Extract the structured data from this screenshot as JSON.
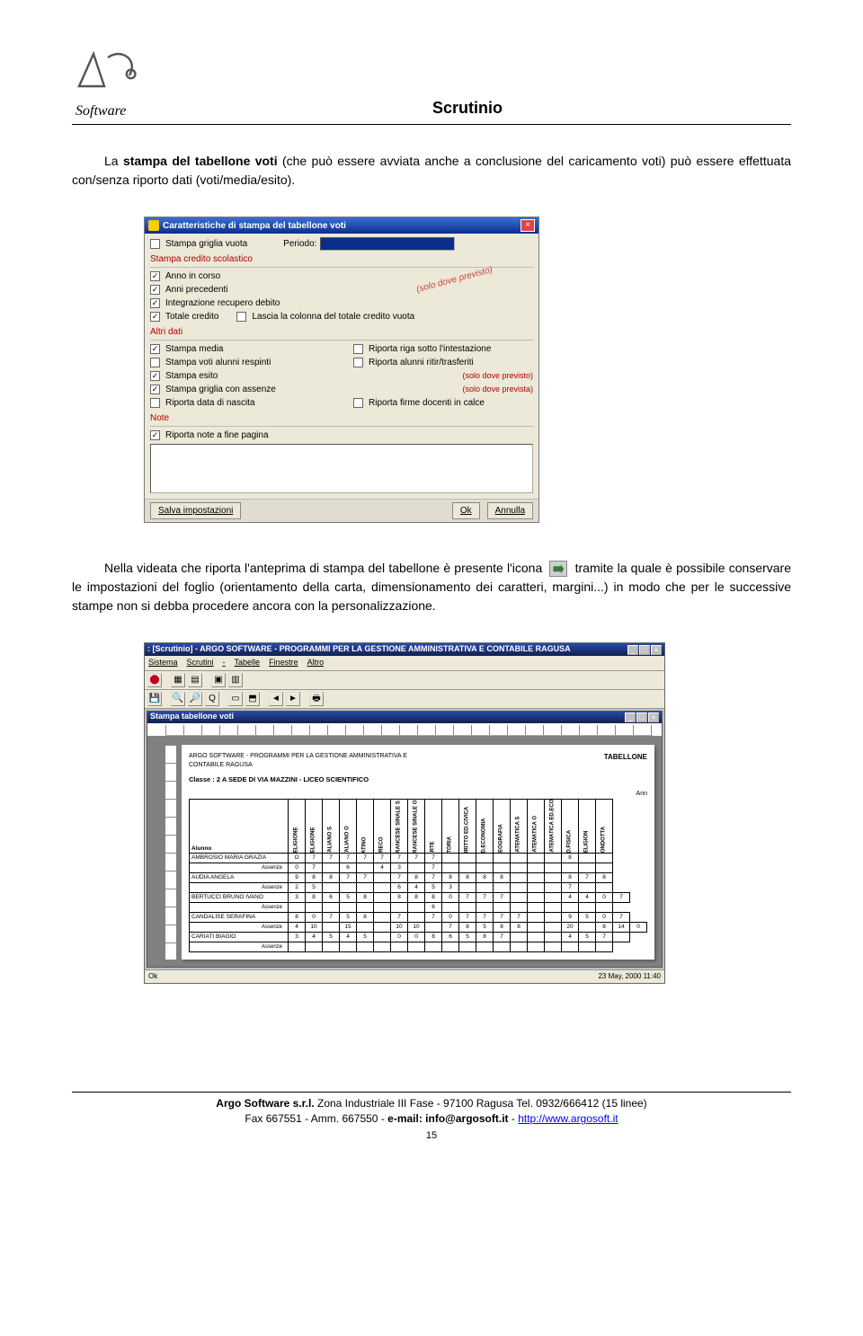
{
  "header": {
    "logo_word": "Software",
    "title": "Scrutinio"
  },
  "para1_a": "La ",
  "para1_b": "stampa del tabellone voti",
  "para1_c": " (che può essere avviata anche a conclusione del caricamento voti) può essere effettuata con/senza riporto dati (voti/media/esito).",
  "dialog1": {
    "title": "Caratteristiche  di stampa del tabellone voti",
    "top_row": {
      "griglia": "Stampa griglia vuota",
      "periodo_lbl": "Periodo:"
    },
    "group_credito": "Stampa credito scolastico",
    "credito": {
      "anno_corso": "Anno in corso",
      "anni_prec": "Anni precedenti",
      "integr": "Integrazione recupero debito",
      "totale": "Totale credito",
      "lascia": "Lascia la colonna del totale credito vuota"
    },
    "wm1": "(solo dove previsto)",
    "group_altri": "Altri dati",
    "altri": {
      "media": "Stampa media",
      "respinti": "Stampa voti alunni respinti",
      "esito": "Stampa esito",
      "griglia_ass": "Stampa griglia con assenze",
      "data_nasc": "Riporta data di nascita",
      "riga_sotto": "Riporta riga sotto l'intestazione",
      "ritir": "Riporta alunni ritir/trasferiti",
      "solo1": "(solo dove previsto)",
      "solo2": "(solo dove prevista)",
      "firme": "Riporta firme docenti in calce"
    },
    "group_note": "Note",
    "note_cb": "Riporta note a fine pagina",
    "btn_save": "Salva impostazioni",
    "btn_ok": "Ok",
    "btn_annulla": "Annulla"
  },
  "para2_a": "Nella videata che riporta l'anteprima di stampa del tabellone è presente l'icona",
  "para2_b": "tramite la quale è possibile conservare le impostazioni del foglio (orientamento della carta, dimensionamento dei caratteri, margini...) in modo che per le successive stampe non si debba procedere ancora con la personalizzazione.",
  "appwin": {
    "title": ": [Scrutinio] - ARGO SOFTWARE - PROGRAMMI PER LA GESTIONE AMMINISTRATIVA E CONTABILE RAGUSA",
    "menu": [
      "Sistema",
      "Scrutini",
      "-",
      "Tabelle",
      "Finestre",
      "Altro"
    ],
    "sub_title": "Stampa tabellone voti",
    "paper_header1": "ARGO SOFTWARE - PROGRAMMI PER LA GESTIONE AMMINISTRATIVA E",
    "paper_header2": "CONTABILE RAGUSA",
    "tabellone": "TABELLONE",
    "classe": "Classe : 2 A SEDE DI VIA MAZZINI - LICEO SCIENTIFICO",
    "ann": "Ann",
    "alunno_hdr": "Alunno",
    "assenze_lbl": "Assenze",
    "subjects": [
      "RELIGIONE",
      "RELIGIONE",
      "ITALIANO S",
      "ITALIANO O",
      "LATINO",
      "GRECO",
      "FRANCESE SINALE S",
      "FRANCESE SINALE O",
      "ARTE",
      "STORIA",
      "DIRITTO ED.CIVICA",
      "ED.ECONOMIA",
      "GEOGRAFIA",
      "MATEMATICA S",
      "MATEMATICA O",
      "MATEMATICA ED.ECONOMIA",
      "ED.FISICA",
      "RELIGION",
      "CONDOTTA"
    ],
    "students": [
      {
        "name": "AMBROSIO MARIA GRAZIA",
        "grades": [
          "O",
          "7",
          "7",
          "7",
          "7",
          "7",
          "7",
          "7",
          "7",
          "",
          "",
          "",
          "",
          "",
          "",
          "",
          "8",
          "",
          ""
        ],
        "abs": [
          "0",
          "7",
          "",
          "6",
          "",
          "4",
          "3",
          "",
          "7",
          "",
          "",
          "",
          "",
          "",
          "",
          "",
          "",
          "",
          ""
        ]
      },
      {
        "name": "AUDIA ANGELA",
        "grades": [
          "9",
          "8",
          "8",
          "7",
          "7",
          "",
          "7",
          "8",
          "7",
          "8",
          "8",
          "8",
          "8",
          "",
          "",
          "",
          "8",
          "7",
          "8"
        ],
        "abs": [
          "2",
          "5",
          "",
          "",
          "",
          "",
          "6",
          "4",
          "5",
          "3",
          "",
          "",
          "",
          "",
          "",
          "",
          "7",
          "",
          ""
        ]
      },
      {
        "name": "BERTUCCI BRUNO IVANO",
        "grades": [
          "3",
          "8",
          "6",
          "5",
          "8",
          "",
          "8",
          "8",
          "8",
          "0",
          "7",
          "7",
          "7",
          "",
          "",
          "",
          "4",
          "4",
          "0",
          "7"
        ],
        "abs": [
          "",
          "",
          "",
          "",
          "",
          "",
          "",
          "",
          "6",
          "",
          "",
          "",
          "",
          "",
          "",
          "",
          "",
          "",
          ""
        ]
      },
      {
        "name": "CANDALISE SERAFINA",
        "grades": [
          "8",
          "0",
          "7",
          "5",
          "8",
          "",
          "7",
          "",
          "7",
          "0",
          "7",
          "7",
          "7",
          "7",
          "",
          "",
          "9",
          "5",
          "0",
          "7"
        ],
        "abs": [
          "4",
          "10",
          "",
          "15",
          "",
          "",
          "10",
          "10",
          "",
          "7",
          "8",
          "5",
          "8",
          "8",
          "",
          "",
          "20",
          "",
          "8",
          "14",
          "0"
        ]
      },
      {
        "name": "CARIATI BIAGIO",
        "grades": [
          "3",
          "4",
          "5",
          "4",
          "5",
          "",
          "0",
          "0",
          "8",
          "6",
          "5",
          "8",
          "7",
          "",
          "",
          "",
          "4",
          "5",
          "7",
          ""
        ],
        "abs": [
          "",
          "",
          "",
          "",
          "",
          "",
          "",
          "",
          "",
          "",
          "",
          "",
          "",
          "",
          "",
          "",
          "",
          "",
          ""
        ]
      }
    ],
    "status_l": "Ok",
    "status_r": "23 May, 2000 11:40"
  },
  "footer": {
    "line1_a": "Argo Software s.r.l.",
    "line1_b": " Zona Industriale III Fase - 97100 Ragusa Tel. 0932/666412 (15 linee)",
    "line2_a": "Fax 667551 - Amm. 667550 - ",
    "line2_b": "e-mail: info@argosoft.it",
    "line2_c": " - ",
    "line2_d": "http://www.argosoft.it",
    "page": "15"
  }
}
